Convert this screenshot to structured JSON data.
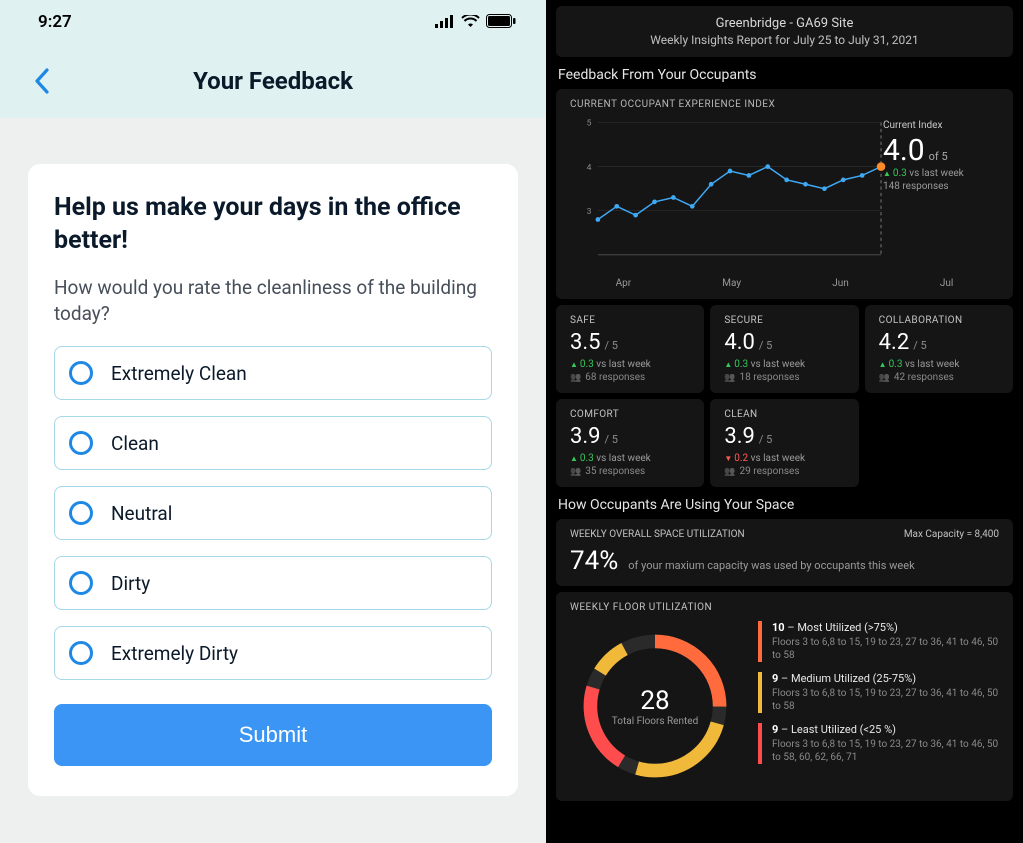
{
  "phone": {
    "status_time": "9:27",
    "header_title": "Your Feedback",
    "card_title": "Help us make your days in the office better!",
    "question": "How would you rate the cleanliness of the building today?",
    "options": [
      "Extremely Clean",
      "Clean",
      "Neutral",
      "Dirty",
      "Extremely Dirty"
    ],
    "submit_label": "Submit"
  },
  "dashboard": {
    "site_name": "Greenbridge - GA69 Site",
    "report_range": "Weekly Insights Report for July 25 to July 31, 2021",
    "section_feedback": "Feedback From Your Occupants",
    "chart_title": "CURRENT OCCUPANT EXPERIENCE INDEX",
    "current_label": "Current Index",
    "current_value": "4.0",
    "current_of": "of 5",
    "current_delta": "0.3",
    "current_delta_suffix": "vs last week",
    "current_responses": "148 responses",
    "tiles": {
      "safe": {
        "label": "SAFE",
        "value": "3.5",
        "of": "/ 5",
        "delta": "0.3",
        "delta_dir": "up",
        "delta_suffix": "vs last week",
        "responses": "68 responses"
      },
      "secure": {
        "label": "SECURE",
        "value": "4.0",
        "of": "/ 5",
        "delta": "0.3",
        "delta_dir": "up",
        "delta_suffix": "vs last week",
        "responses": "18 responses"
      },
      "collab": {
        "label": "COLLABORATION",
        "value": "4.2",
        "of": "/ 5",
        "delta": "0.3",
        "delta_dir": "up",
        "delta_suffix": "vs last week",
        "responses": "42 responses"
      },
      "comfort": {
        "label": "COMFORT",
        "value": "3.9",
        "of": "/ 5",
        "delta": "0.3",
        "delta_dir": "up",
        "delta_suffix": "vs last week",
        "responses": "35 responses"
      },
      "clean": {
        "label": "CLEAN",
        "value": "3.9",
        "of": "/ 5",
        "delta": "0.2",
        "delta_dir": "down",
        "delta_suffix": "vs last week",
        "responses": "29 responses"
      }
    },
    "section_usage": "How Occupants Are Using Your Space",
    "util_title": "WEEKLY OVERALL SPACE UTILIZATION",
    "util_capacity": "Max Capacity = 8,400",
    "util_pct": "74%",
    "util_desc": "of your maxium capacity was used by occupants this week",
    "floor_title": "WEEKLY FLOOR UTILIZATION",
    "donut_center": "28",
    "donut_label": "Total Floors Rented",
    "floor_items": {
      "most": {
        "count": "10",
        "label": "Most Utilized (>75%)",
        "detail": "Floors 3 to 6,8 to 15, 19 to 23, 27 to 36, 41 to 46, 50 to 58"
      },
      "medium": {
        "count": "9",
        "label": "Medium Utilized (25-75%)",
        "detail": "Floors 3 to 6,8 to 15, 19 to 23, 27 to 36, 41 to 46, 50 to 58"
      },
      "least": {
        "count": "9",
        "label": "Least Utilized (<25 %)",
        "detail": "Floors 3 to 6,8 to 15, 19 to 23, 27 to 36, 41 to 46, 50 to 58, 60, 62, 66, 71"
      }
    },
    "month_labels": [
      "Apr",
      "May",
      "Jun",
      "Jul"
    ]
  },
  "chart_data": {
    "type": "line",
    "x": [
      0,
      1,
      2,
      3,
      4,
      5,
      6,
      7,
      8,
      9,
      10,
      11,
      12,
      13,
      14,
      15
    ],
    "values": [
      2.8,
      3.1,
      2.9,
      3.2,
      3.3,
      3.1,
      3.6,
      3.9,
      3.8,
      4.0,
      3.7,
      3.6,
      3.5,
      3.7,
      3.8,
      4.0
    ],
    "ylim": [
      2,
      5
    ],
    "yticks": [
      3,
      4,
      5
    ],
    "x_month_labels": [
      "Apr",
      "May",
      "Jun",
      "Jul"
    ],
    "current_index_x": 15,
    "title": "CURRENT OCCUPANT EXPERIENCE INDEX"
  }
}
